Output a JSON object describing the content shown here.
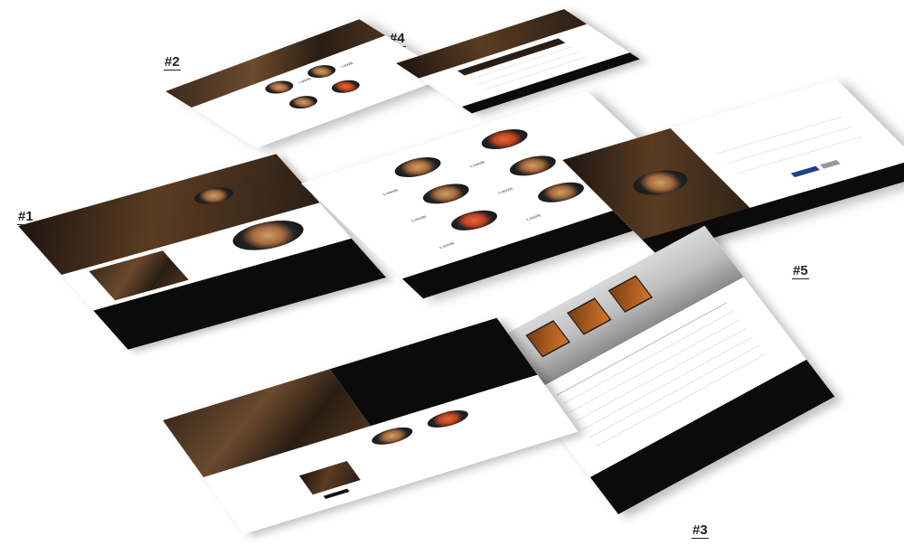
{
  "labels": [
    "#1",
    "#2",
    "#3",
    "#4",
    "#5"
  ],
  "prices": [
    "1,000원",
    "1,000원",
    "1,000원",
    "1,000원",
    "1,000원",
    "1,000원",
    "1,000원",
    "1,000원"
  ]
}
